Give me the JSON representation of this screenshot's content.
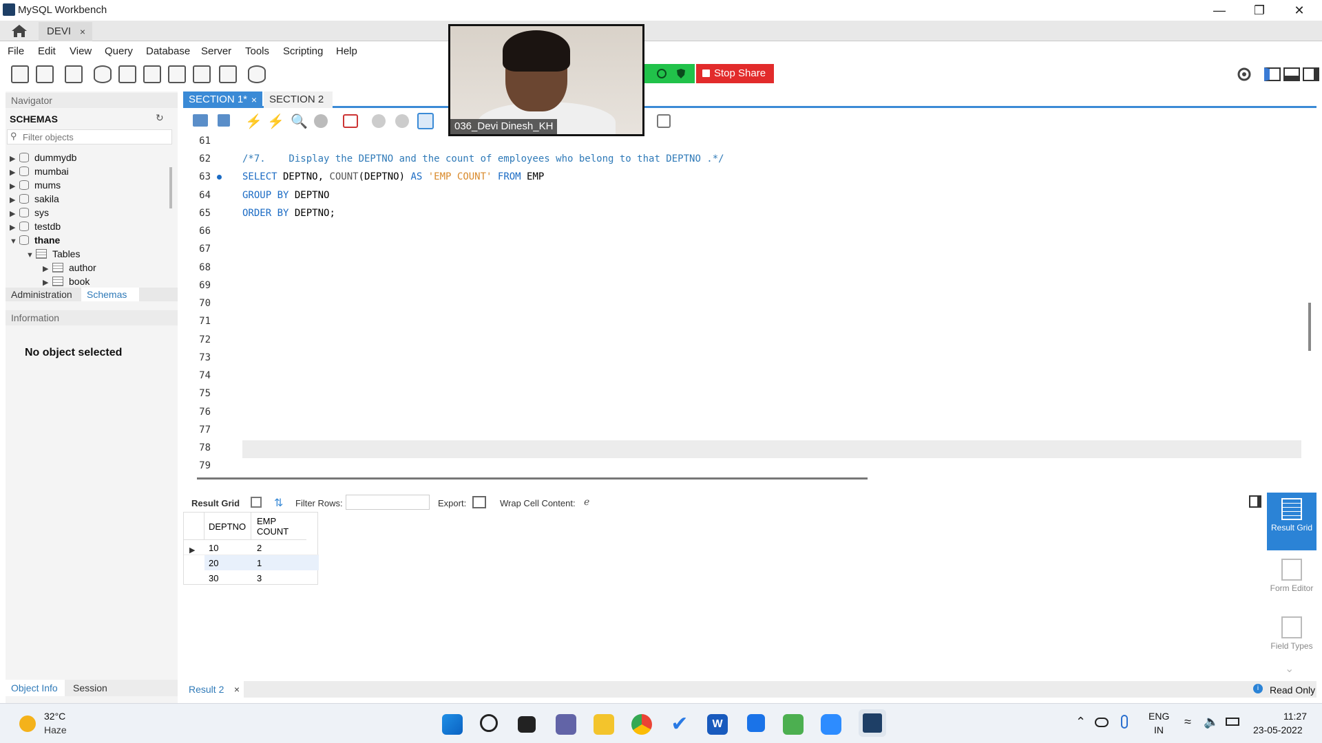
{
  "window": {
    "title": "MySQL Workbench",
    "connection_tab": "DEVI",
    "close_glyph": "×"
  },
  "menu": [
    "File",
    "Edit",
    "View",
    "Query",
    "Database",
    "Server",
    "Tools",
    "Scripting",
    "Help"
  ],
  "webcam": {
    "name": "036_Devi Dinesh_KH"
  },
  "share": {
    "stop_label": "Stop Share"
  },
  "navigator": {
    "header": "Navigator",
    "schemas_label": "SCHEMAS",
    "filter_placeholder": "Filter objects",
    "schemas": [
      "dummydb",
      "mumbai",
      "mums",
      "sakila",
      "sys",
      "testdb",
      "thane"
    ],
    "thane_children": {
      "folder": "Tables",
      "tables": [
        "author",
        "book"
      ]
    },
    "tabs": [
      "Administration",
      "Schemas"
    ],
    "info_header": "Information",
    "no_object": "No object selected",
    "bottom_tabs": [
      "Object Info",
      "Session"
    ]
  },
  "editor": {
    "tabs": [
      {
        "label": "SECTION 1*",
        "close": "×"
      },
      {
        "label": "SECTION 2"
      }
    ],
    "line_numbers": [
      "61",
      "62",
      "63",
      "64",
      "65",
      "66",
      "67",
      "68",
      "69",
      "70",
      "71",
      "72",
      "73",
      "74",
      "75",
      "76",
      "77",
      "78",
      "79"
    ],
    "comment_line": "/*7.    Display the DEPTNO and the count of employees who belong to that DEPTNO .*/",
    "line63": {
      "kw1": "SELECT",
      "t1": " DEPTNO, ",
      "fn": "COUNT",
      "t2": "(DEPTNO) ",
      "kw2": "AS",
      "str": " 'EMP COUNT' ",
      "kw3": "FROM",
      "t3": " EMP"
    },
    "line64": {
      "kw": "GROUP BY",
      "t": " DEPTNO"
    },
    "line65": {
      "kw": "ORDER BY",
      "t": " DEPTNO;"
    }
  },
  "results": {
    "result_grid_label": "Result Grid",
    "filter_rows_label": "Filter Rows:",
    "export_label": "Export:",
    "wrap_label": "Wrap Cell Content:",
    "columns": [
      "DEPTNO",
      "EMP COUNT"
    ],
    "rows": [
      [
        "10",
        "2"
      ],
      [
        "20",
        "1"
      ],
      [
        "30",
        "3"
      ]
    ],
    "side_buttons": [
      "Result Grid",
      "Form Editor",
      "Field Types"
    ],
    "bottom_tab": "Result 2",
    "status": "Read Only"
  },
  "taskbar": {
    "weather_temp": "32°C",
    "weather_desc": "Haze",
    "lang_top": "ENG",
    "lang_bottom": "IN",
    "time": "11:27",
    "date": "23-05-2022"
  }
}
